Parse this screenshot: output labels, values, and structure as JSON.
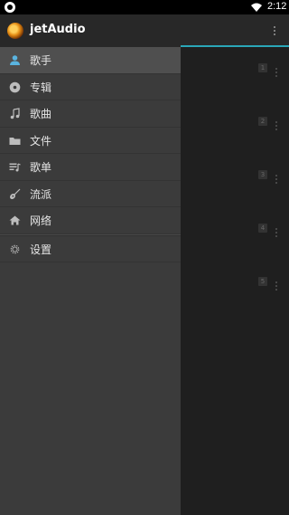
{
  "status_bar": {
    "time": "2:12",
    "icons": [
      "app-notification-icon",
      "wifi-icon"
    ]
  },
  "app": {
    "title": "jetAudio"
  },
  "drawer": {
    "items": [
      {
        "label": "歌手",
        "icon": "person-icon",
        "selected": true
      },
      {
        "label": "专辑",
        "icon": "album-disc-icon",
        "selected": false
      },
      {
        "label": "歌曲",
        "icon": "music-note-icon",
        "selected": false
      },
      {
        "label": "文件",
        "icon": "folder-icon",
        "selected": false
      },
      {
        "label": "歌单",
        "icon": "playlist-icon",
        "selected": false
      },
      {
        "label": "流派",
        "icon": "guitar-icon",
        "selected": false
      },
      {
        "label": "网络",
        "icon": "network-home-icon",
        "selected": false
      }
    ],
    "settings": {
      "label": "设置",
      "icon": "gear-icon"
    }
  },
  "background_list": {
    "badges": [
      "1",
      "2",
      "3",
      "4",
      "5"
    ]
  },
  "colors": {
    "accent": "#2aa7b8",
    "drawer_bg": "#3b3b3b",
    "selected_bg": "#4f4f4f"
  }
}
